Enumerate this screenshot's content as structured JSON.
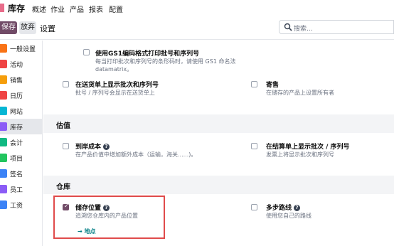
{
  "topbar": {
    "app_name": "库存",
    "menu": [
      "概述",
      "作业",
      "产品",
      "报表",
      "配置"
    ]
  },
  "control": {
    "save_label": "保存",
    "discard_label": "放弃",
    "breadcrumb": "设置",
    "search_placeholder": "搜索..."
  },
  "sidebar": {
    "items": [
      {
        "label": "一般设置",
        "color": "#f97316"
      },
      {
        "label": "活动",
        "color": "#ef4444"
      },
      {
        "label": "销售",
        "color": "#f59e0b"
      },
      {
        "label": "日历",
        "color": "#ef4444"
      },
      {
        "label": "网站",
        "color": "#06b6d4"
      },
      {
        "label": "库存",
        "color": "#8b5cf6"
      },
      {
        "label": "会计",
        "color": "#10b981"
      },
      {
        "label": "项目",
        "color": "#22c55e"
      },
      {
        "label": "签名",
        "color": "#3b82f6"
      },
      {
        "label": "员工",
        "color": "#8b5cf6"
      },
      {
        "label": "工资",
        "color": "#3b82f6"
      }
    ],
    "active_index": 5
  },
  "content": {
    "gs1": {
      "title": "使用GS1编码格式打印批号和序列号",
      "desc1": "每当打印批次和序列号的条形码时，请使用 GS1 命名法",
      "desc2": "datamatrix。"
    },
    "lots_on_delivery": {
      "title": "在送货单上显示批次和序列号",
      "desc": "批号 / 序列号会显示在送货单上"
    },
    "consignment": {
      "title": "寄售",
      "desc": "在储存的产品上设置所有者"
    },
    "valuation_heading": "估值",
    "landed_cost": {
      "title": "到岸成本",
      "desc": "在产品价值中增加额外成本（运输，海关......)。"
    },
    "lots_on_invoice": {
      "title": "在结算单上显示批次 / 序列号",
      "desc": "发票上将显示批次和序列号"
    },
    "warehouse_heading": "仓库",
    "storage_locations": {
      "title": "储存位置",
      "desc": "追溯您仓库内的产品位置",
      "link": "→ 地点",
      "checked": true
    },
    "multi_step_routes": {
      "title": "多步路线",
      "desc": "使用您自己的路线",
      "checked": false
    }
  }
}
